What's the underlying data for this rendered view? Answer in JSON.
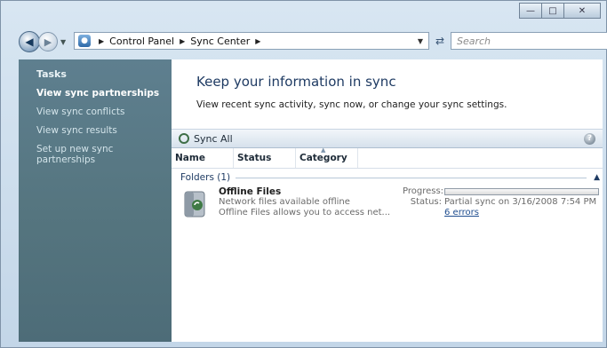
{
  "window": {
    "caption_buttons": [
      "minimize-icon",
      "maximize-icon",
      "close-icon"
    ]
  },
  "address_bar": {
    "crumbs": [
      "Control Panel",
      "Sync Center"
    ],
    "search_placeholder": "Search"
  },
  "tasks": {
    "heading": "Tasks",
    "links": [
      "View sync partnerships",
      "View sync conflicts",
      "View sync results",
      "Set up new sync partnerships"
    ]
  },
  "main": {
    "headline": "Keep your information in sync",
    "subtext": "View recent sync activity, sync now, or change your sync settings.",
    "toolbar": {
      "sync_all": "Sync All"
    },
    "columns": [
      "Name",
      "Status",
      "Category"
    ],
    "group": {
      "label": "Folders (1)"
    },
    "item": {
      "title": "Offline Files",
      "line1": "Network files available offline",
      "line2": "Offline Files allows you to access net...",
      "progress_label": "Progress:",
      "progress_fraction": 0.0,
      "status_label": "Status:",
      "status_value": "Partial sync on 3/16/2008 7:54 PM",
      "errors": "6 errors"
    }
  },
  "colors": {
    "task_pane": "#55757f",
    "headline": "#1f3b63",
    "link": "#1f4d8f"
  }
}
